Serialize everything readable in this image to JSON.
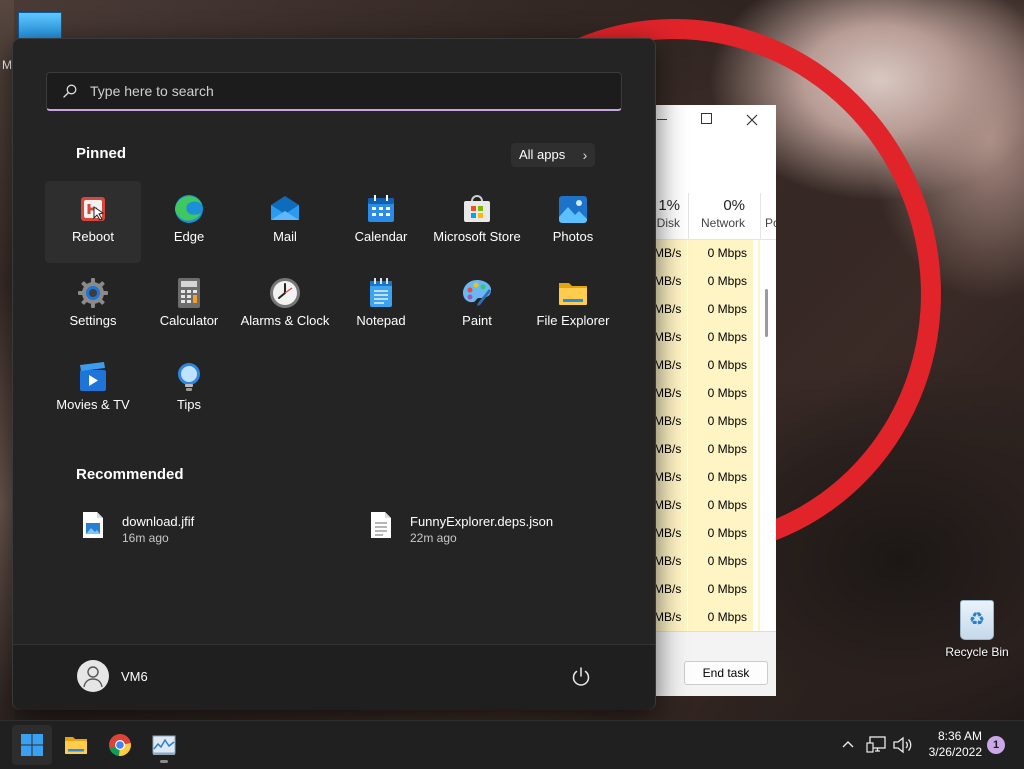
{
  "desktop": {
    "partial_label": "M",
    "recycle_bin_label": "Recycle Bin"
  },
  "task_manager": {
    "disk_pct": "1%",
    "disk_label": "Disk",
    "network_pct": "0%",
    "network_label": "Network",
    "partial_col_label": "Po",
    "rows": [
      {
        "disk": "MB/s",
        "network": "0 Mbps"
      },
      {
        "disk": "MB/s",
        "network": "0 Mbps"
      },
      {
        "disk": "MB/s",
        "network": "0 Mbps"
      },
      {
        "disk": "MB/s",
        "network": "0 Mbps"
      },
      {
        "disk": "MB/s",
        "network": "0 Mbps"
      },
      {
        "disk": "MB/s",
        "network": "0 Mbps"
      },
      {
        "disk": "MB/s",
        "network": "0 Mbps"
      },
      {
        "disk": "MB/s",
        "network": "0 Mbps"
      },
      {
        "disk": "MB/s",
        "network": "0 Mbps"
      },
      {
        "disk": "MB/s",
        "network": "0 Mbps"
      },
      {
        "disk": "MB/s",
        "network": "0 Mbps"
      },
      {
        "disk": "MB/s",
        "network": "0 Mbps"
      },
      {
        "disk": "MB/s",
        "network": "0 Mbps"
      },
      {
        "disk": "MB/s",
        "network": "0 Mbps"
      }
    ],
    "end_task_label": "End task"
  },
  "start_menu": {
    "search": {
      "placeholder": "Type here to search",
      "value": ""
    },
    "pinned_heading": "Pinned",
    "all_apps_label": "All apps",
    "pinned": [
      {
        "label": "Reboot",
        "icon": "reboot-icon"
      },
      {
        "label": "Edge",
        "icon": "edge-icon"
      },
      {
        "label": "Mail",
        "icon": "mail-icon"
      },
      {
        "label": "Calendar",
        "icon": "calendar-icon"
      },
      {
        "label": "Microsoft Store",
        "icon": "store-icon"
      },
      {
        "label": "Photos",
        "icon": "photos-icon"
      },
      {
        "label": "Settings",
        "icon": "settings-icon"
      },
      {
        "label": "Calculator",
        "icon": "calculator-icon"
      },
      {
        "label": "Alarms & Clock",
        "icon": "clock-icon"
      },
      {
        "label": "Notepad",
        "icon": "notepad-icon"
      },
      {
        "label": "Paint",
        "icon": "paint-icon"
      },
      {
        "label": "File Explorer",
        "icon": "folder-icon"
      },
      {
        "label": "Movies & TV",
        "icon": "movies-icon"
      },
      {
        "label": "Tips",
        "icon": "lightbulb-icon"
      }
    ],
    "recommended_heading": "Recommended",
    "recommended": [
      {
        "name": "download.jfif",
        "time": "16m ago",
        "icon": "image-file-icon"
      },
      {
        "name": "FunnyExplorer.deps.json",
        "time": "22m ago",
        "icon": "text-file-icon"
      }
    ],
    "user_name": "VM6"
  },
  "taskbar": {
    "apps": [
      "start-button",
      "file-explorer",
      "chrome",
      "task-manager"
    ],
    "time": "8:36 AM",
    "date": "3/26/2022",
    "notification_count": "1"
  },
  "colors": {
    "accent": "#c9a8e8",
    "start_bg": "#242424",
    "taskbar_bg": "#202020",
    "windows_blue": "#3aa0f0"
  }
}
